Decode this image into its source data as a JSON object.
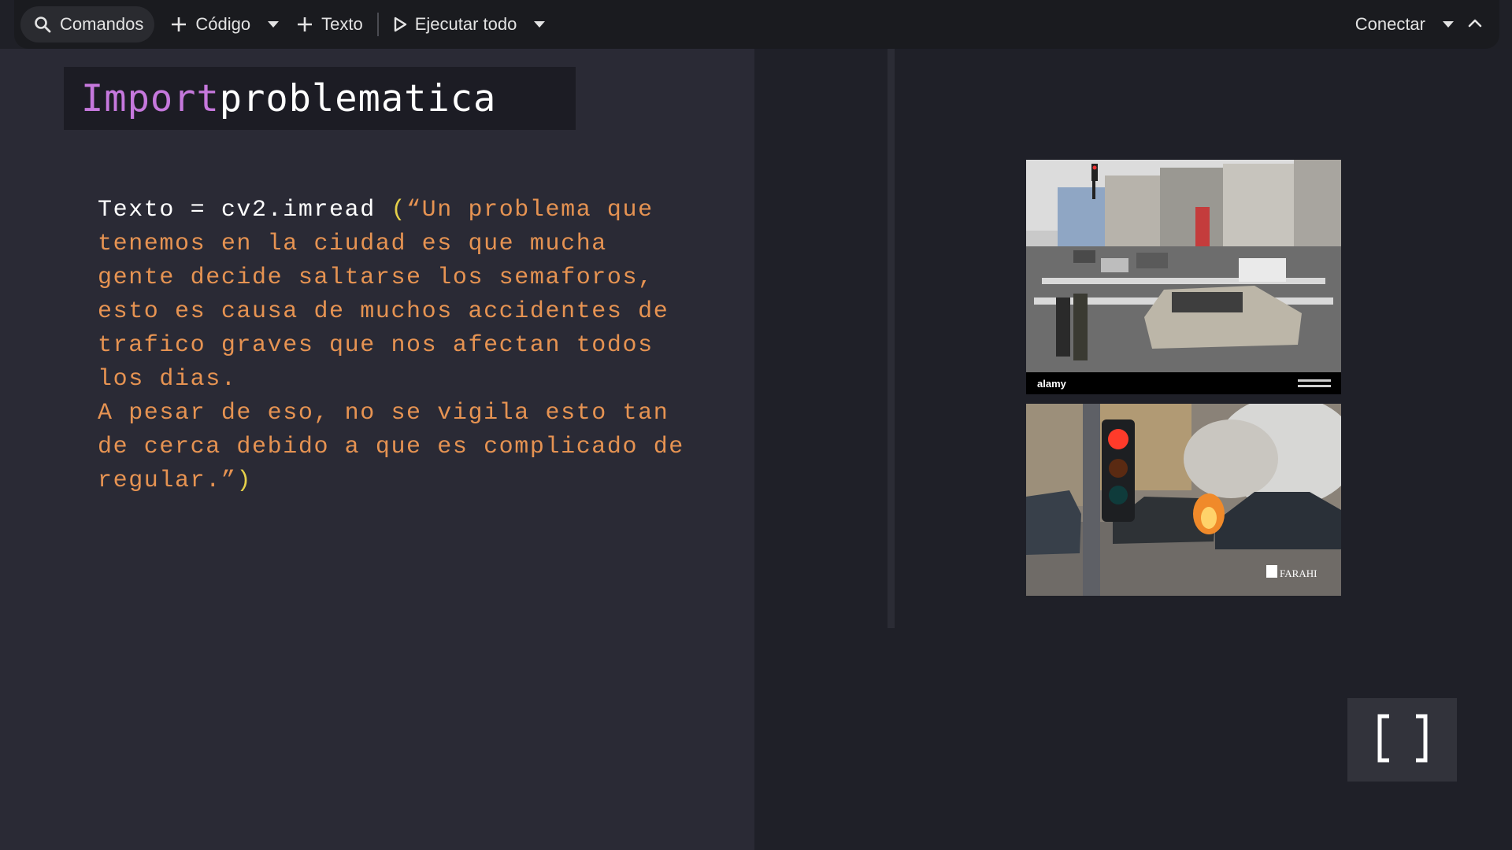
{
  "toolbar": {
    "search_label": "Comandos",
    "code_label": "Código",
    "text_label": "Texto",
    "run_all_label": "Ejecutar todo",
    "connect_label": "Conectar"
  },
  "cell": {
    "title_keyword": "Import",
    "title_rest": "problematica",
    "code_prefix": "Texto = cv2.imread ",
    "paren_open": "(",
    "string_text": "“Un problema que tenemos en la ciudad es que mucha gente decide saltarse los semaforos, esto es causa de muchos accidentes de trafico graves que nos afectan todos los dias.\nA pesar de eso, no se vigila esto tan de cerca debido a que es complicado de regular.”",
    "paren_close": ")"
  },
  "images": {
    "top_watermark": "alamy",
    "bottom_watermark": "FARAHI"
  },
  "colors": {
    "keyword": "#c678dd",
    "string": "#e69352",
    "paren": "#e5d04a",
    "background": "#2a2a35"
  }
}
